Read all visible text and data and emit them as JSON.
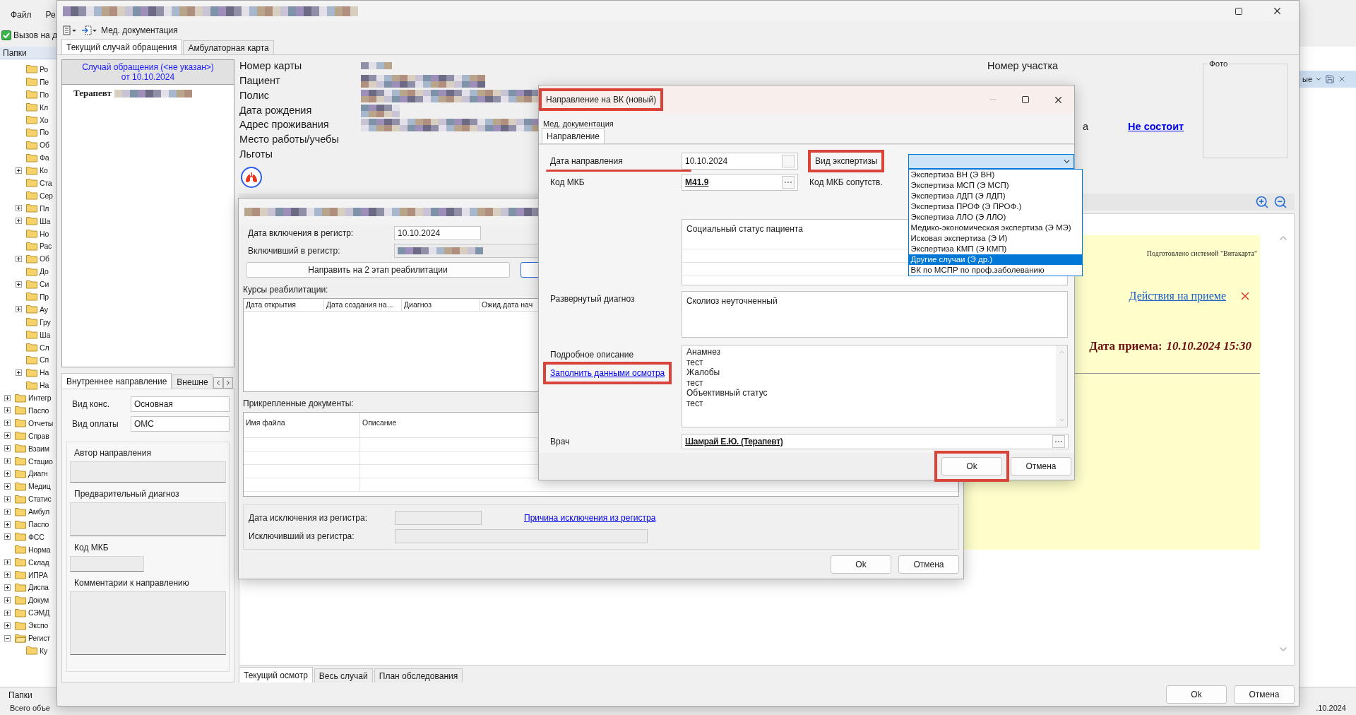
{
  "app": {
    "menu": [
      "Файл",
      "Ре"
    ],
    "toolbar_item": "Вызов на д",
    "folders_header": "Папки",
    "bottom_tab": "Папки",
    "status": "Всего объе",
    "status_date": ".10.2024",
    "right_panel_label": "ые"
  },
  "folder_tree": {
    "partial_children": [
      {
        "label": "Ро",
        "expandable": false,
        "expanded": false
      },
      {
        "label": "Пе",
        "expandable": false,
        "expanded": false
      },
      {
        "label": "По",
        "expandable": false,
        "expanded": false
      },
      {
        "label": "Кл",
        "expandable": false,
        "expanded": false
      },
      {
        "label": "Хо",
        "expandable": false,
        "expanded": false
      },
      {
        "label": "По",
        "expandable": false,
        "expanded": false
      },
      {
        "label": "Об",
        "expandable": false,
        "expanded": false
      },
      {
        "label": "Фа",
        "expandable": false,
        "expanded": false
      },
      {
        "label": "Ко",
        "expandable": true,
        "expanded": false
      },
      {
        "label": "Ста",
        "expandable": false,
        "expanded": false
      },
      {
        "label": "Сер",
        "expandable": false,
        "expanded": false
      },
      {
        "label": "Пл",
        "expandable": true,
        "expanded": false
      },
      {
        "label": "Ша",
        "expandable": true,
        "expanded": false
      },
      {
        "label": "Но",
        "expandable": false,
        "expanded": false
      },
      {
        "label": "Рас",
        "expandable": false,
        "expanded": false
      },
      {
        "label": "Об",
        "expandable": true,
        "expanded": false
      },
      {
        "label": "До",
        "expandable": false,
        "expanded": false
      },
      {
        "label": "Си",
        "expandable": true,
        "expanded": false
      },
      {
        "label": "Пр",
        "expandable": false,
        "expanded": false
      },
      {
        "label": "Ау",
        "expandable": true,
        "expanded": false
      },
      {
        "label": "Гру",
        "expandable": false,
        "expanded": false
      },
      {
        "label": "Ша",
        "expandable": false,
        "expanded": false
      },
      {
        "label": "Сл",
        "expandable": false,
        "expanded": false
      },
      {
        "label": "Сп",
        "expandable": false,
        "expanded": false
      },
      {
        "label": "На",
        "expandable": true,
        "expanded": false
      },
      {
        "label": "На",
        "expandable": false,
        "expanded": false
      }
    ],
    "items": [
      {
        "label": "Интегр",
        "expandable": true,
        "expanded": false
      },
      {
        "label": "Паспо",
        "expandable": true,
        "expanded": false
      },
      {
        "label": "Отчеты",
        "expandable": true,
        "expanded": false
      },
      {
        "label": "Справ",
        "expandable": true,
        "expanded": false
      },
      {
        "label": "Взаим",
        "expandable": true,
        "expanded": false
      },
      {
        "label": "Стацио",
        "expandable": true,
        "expanded": false
      },
      {
        "label": "Диагн",
        "expandable": true,
        "expanded": false
      },
      {
        "label": "Медиц",
        "expandable": true,
        "expanded": false
      },
      {
        "label": "Статис",
        "expandable": true,
        "expanded": false
      },
      {
        "label": "Амбул",
        "expandable": true,
        "expanded": false
      },
      {
        "label": "Паспо",
        "expandable": true,
        "expanded": false
      },
      {
        "label": "ФСС",
        "expandable": true,
        "expanded": false
      },
      {
        "label": "Норма",
        "expandable": false,
        "expanded": false
      },
      {
        "label": "Склад",
        "expandable": true,
        "expanded": false
      },
      {
        "label": "ИПРА",
        "expandable": true,
        "expanded": false
      },
      {
        "label": "Диспа",
        "expandable": true,
        "expanded": false
      },
      {
        "label": "Докум",
        "expandable": true,
        "expanded": false
      },
      {
        "label": "СЭМД",
        "expandable": true,
        "expanded": false
      },
      {
        "label": "Экспо",
        "expandable": true,
        "expanded": false
      },
      {
        "label": "Регист",
        "expandable": true,
        "expanded": true,
        "children": [
          {
            "label": "Ку",
            "expandable": false,
            "expanded": false
          }
        ]
      }
    ]
  },
  "main_window": {
    "toolbar_label": "Мед. документация",
    "tabs": [
      {
        "label": "Текущий случай обращения",
        "selected": true
      },
      {
        "label": "Амбулаторная карта",
        "selected": false
      }
    ],
    "case_panel": {
      "header": [
        "Случай обращения (<не указан>)",
        "от 10.10.2024"
      ],
      "items": [
        {
          "label": "Терапевт"
        }
      ]
    },
    "referral_tabs": [
      {
        "label": "Внутреннее направление",
        "selected": true
      },
      {
        "label": "Внешне",
        "selected": false
      }
    ],
    "referral_fields": [
      {
        "label": "Вид конс.",
        "value": "Основная"
      },
      {
        "label": "Вид оплаты",
        "value": "ОМС"
      }
    ],
    "referral_groups": [
      {
        "label": "Автор направления",
        "kind": "line"
      },
      {
        "label": "Предварительный диагноз",
        "kind": "area"
      },
      {
        "label": "Код МКБ",
        "kind": "short"
      },
      {
        "label": "Комментарии к направлению",
        "kind": "tall"
      }
    ],
    "patient_labels": [
      "Номер карты",
      "Пациент",
      "Полис",
      "Дата рождения",
      "Адрес проживания",
      "Место работы/учебы",
      "Льготы"
    ],
    "district_label": "Номер участка",
    "district_label_tail": "а",
    "membership_link": "Не состоит",
    "photo_label": "Фото",
    "document": {
      "credit": "Подготовлено системой \"Витакарта\"",
      "actions_link": "Действия на приеме",
      "visit_label": "Дата приема:",
      "visit_value": "10.10.2024 15:30"
    },
    "bottom_tabs": [
      {
        "label": "Текущий осмотр",
        "selected": true
      },
      {
        "label": "Весь случай",
        "selected": false
      },
      {
        "label": "План обследования",
        "selected": false
      }
    ],
    "buttons": [
      "Ok",
      "Отмена"
    ]
  },
  "registry_window": {
    "inclusion_date_label": "Дата включения в регистр:",
    "inclusion_date": "10.10.2024",
    "included_by_label": "Включивший в регистр:",
    "rehab_button": "Направить на 2 этап реабилитации",
    "courses_label": "Курсы реабилитации:",
    "courses_columns": [
      "Дата открытия",
      "Дата создания на...",
      "Диагноз",
      "Ожид.дата нач"
    ],
    "docs_label": "Прикрепленные документы:",
    "docs_columns": [
      "Имя файла",
      "Описание"
    ],
    "exclusion_date_label": "Дата исключения из регистра:",
    "exclusion_reason_link": "Причина исключения из регистра",
    "excluded_by_label": "Исключивший из регистра:",
    "buttons": [
      "Ok",
      "Отмена"
    ]
  },
  "dialog": {
    "title": "Направление на ВК (новый)",
    "title_highlighted": true,
    "menu": "Мед. документация",
    "tabs": [
      {
        "label": "Направление",
        "selected": true
      }
    ],
    "date_label": "Дата направления",
    "date_label_underlined": true,
    "date_value": "10.10.2024",
    "expertise_label": "Вид экспертизы",
    "expertise_label_highlighted": true,
    "expertise_expanded": true,
    "expertise_options": [
      {
        "label": "Экспертиза ВН (Э ВН)",
        "selected": false
      },
      {
        "label": "Экспертиза МСП (Э МСП)",
        "selected": false
      },
      {
        "label": "Экспертиза ЛДП (Э ЛДП)",
        "selected": false
      },
      {
        "label": "Экспертиза ПРОФ (Э ПРОФ.)",
        "selected": false
      },
      {
        "label": "Экспертиза ЛЛО (Э ЛЛО)",
        "selected": false
      },
      {
        "label": "Медико-экономическая экспертиза (Э МЭ)",
        "selected": false
      },
      {
        "label": "Исковая экспертиза (Э И)",
        "selected": false
      },
      {
        "label": "Экспертиза КМП (Э КМП)",
        "selected": false
      },
      {
        "label": "Другие случаи (Э др.)",
        "selected": true
      },
      {
        "label": "ВК по МСПР по проф.заболеванию",
        "selected": false
      }
    ],
    "mkb_label": "Код МКБ",
    "mkb_value": "M41.9",
    "mkb_related_label": "Код МКБ сопутств.",
    "social_status_header": "Социальный статус пациента",
    "diagnosis_label": "Развернутый диагноз",
    "diagnosis_value": "Сколиоз неуточненный",
    "description_label": "Подробное описание",
    "fill_link": "Заполнить данными осмотра",
    "fill_link_highlighted": true,
    "description_lines": [
      "Анамнез",
      "тест",
      "Жалобы",
      "тест",
      "Объективный статус",
      "тест"
    ],
    "doctor_label": "Врач",
    "doctor_value": "Шамрай Е.Ю. (Терапевт)",
    "buttons": [
      {
        "label": "Ok",
        "highlighted": true
      },
      {
        "label": "Отмена",
        "highlighted": false
      }
    ]
  }
}
